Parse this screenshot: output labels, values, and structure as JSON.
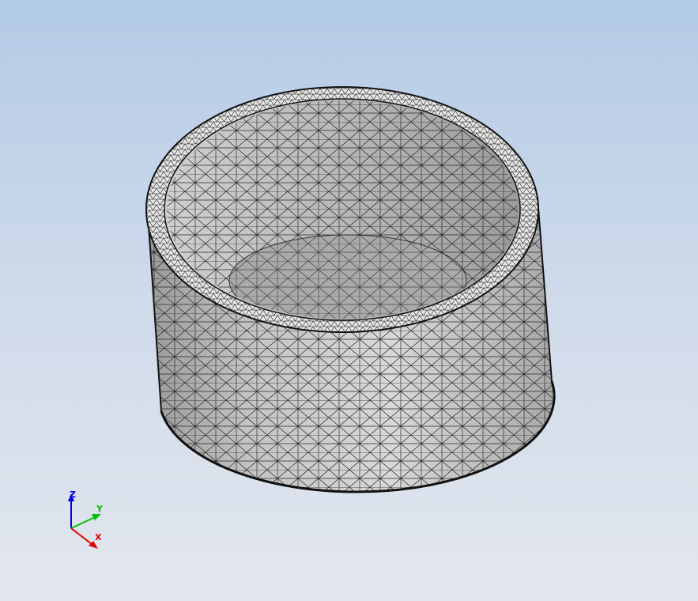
{
  "viewport": {
    "background_top": "#b3cbe6",
    "background_bottom": "#e3e7ee"
  },
  "model": {
    "type": "mesh",
    "shape": "hollow cylinder (cup)",
    "mesh": "triangular",
    "outer_color": "#c9c9c9",
    "inner_color": "#b5b5b5",
    "edge_color": "#222222"
  },
  "triad": {
    "x_label": "X",
    "y_label": "Y",
    "z_label": "Z",
    "x_color": "#e00000",
    "y_color": "#00c000",
    "z_color": "#0000e0"
  }
}
